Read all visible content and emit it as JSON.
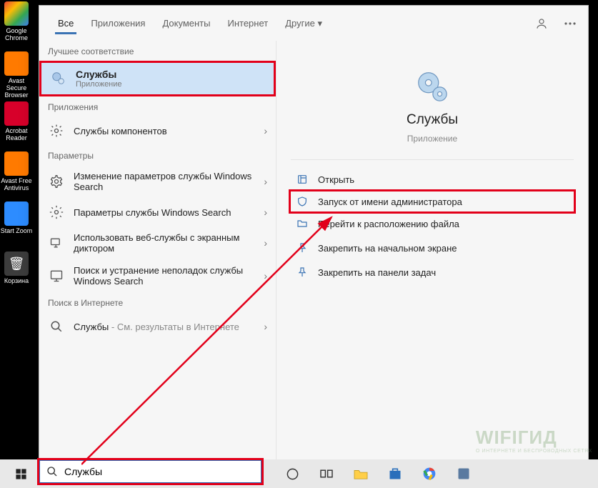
{
  "desktop": [
    {
      "label": "Google Chrome",
      "color": "#fff",
      "bg": "#fff"
    },
    {
      "label": "Avast Secure Browser",
      "color": "#fff",
      "bg": "#ff7a00"
    },
    {
      "label": "Acrobat Reader",
      "color": "#fff",
      "bg": "#d7002a"
    },
    {
      "label": "Avast Free Antivirus",
      "color": "#fff",
      "bg": "#ff7a00"
    },
    {
      "label": "Start Zoom",
      "color": "#fff",
      "bg": "#2d8cff"
    },
    {
      "label": "Корзина",
      "color": "#fff",
      "bg": "#3c3c3c"
    }
  ],
  "tabs": {
    "items": [
      "Все",
      "Приложения",
      "Документы",
      "Интернет",
      "Другие ▾"
    ],
    "active": 0
  },
  "left": {
    "group_best": "Лучшее соответствие",
    "best": {
      "title": "Службы",
      "sub": "Приложение"
    },
    "group_apps": "Приложения",
    "apps": [
      {
        "text": "Службы компонентов"
      }
    ],
    "group_params": "Параметры",
    "params": [
      {
        "text": "Изменение параметров службы Windows Search"
      },
      {
        "text": "Параметры службы Windows Search"
      },
      {
        "text": "Использовать веб-службы с экранным диктором"
      },
      {
        "text": "Поиск и устранение неполадок службы Windows Search"
      }
    ],
    "group_web": "Поиск в Интернете",
    "web": {
      "text": "Службы",
      "suffix": " - См. результаты в Интернете"
    }
  },
  "right": {
    "title": "Службы",
    "sub": "Приложение",
    "actions": [
      {
        "label": "Открыть",
        "highlight": false
      },
      {
        "label": "Запуск от имени администратора",
        "highlight": true
      },
      {
        "label": "Перейти к расположению файла",
        "highlight": false
      },
      {
        "label": "Закрепить на начальном экране",
        "highlight": false
      },
      {
        "label": "Закрепить на панели задач",
        "highlight": false
      }
    ]
  },
  "search": {
    "value": "Службы",
    "placeholder": ""
  },
  "watermark": {
    "line1": "WIFIГИД",
    "line2": "О ИНТЕРНЕТЕ И БЕСПРОВОДНЫХ СЕТЯХ"
  }
}
